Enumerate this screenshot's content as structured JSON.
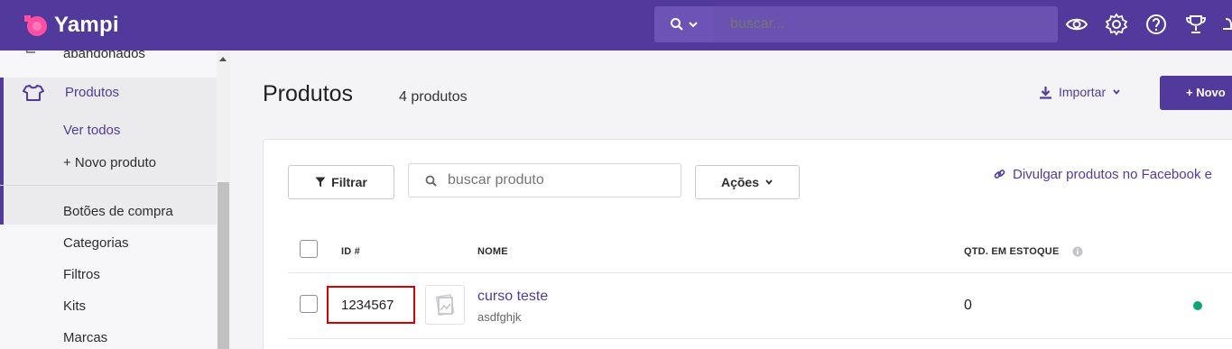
{
  "header": {
    "brand": "Yampi",
    "search_placeholder": "buscar..."
  },
  "sidebar": {
    "prev_item_label": "abandonados",
    "section_label": "Produtos",
    "sub_items": [
      "Ver todos",
      "+ Novo produto"
    ],
    "items": [
      "Botões de compra",
      "Categorias",
      "Filtros",
      "Kits",
      "Marcas"
    ]
  },
  "page": {
    "title": "Produtos",
    "count": "4 produtos",
    "import_label": "Importar",
    "new_label": "+ Novo"
  },
  "toolbar": {
    "filter_label": "Filtrar",
    "search_placeholder": "buscar produto",
    "actions_label": "Ações",
    "facebook_link": "Divulgar produtos no Facebook e"
  },
  "table": {
    "columns": [
      "ID #",
      "NOME",
      "QTD. EM ESTOQUE"
    ],
    "rows": [
      {
        "id": "1234567",
        "name": "curso teste",
        "sku": "asdfghjk",
        "qty": "0",
        "status_color": "#0ea572"
      }
    ]
  },
  "colors": {
    "brand": "#523a9c",
    "highlight": "#d60000"
  }
}
